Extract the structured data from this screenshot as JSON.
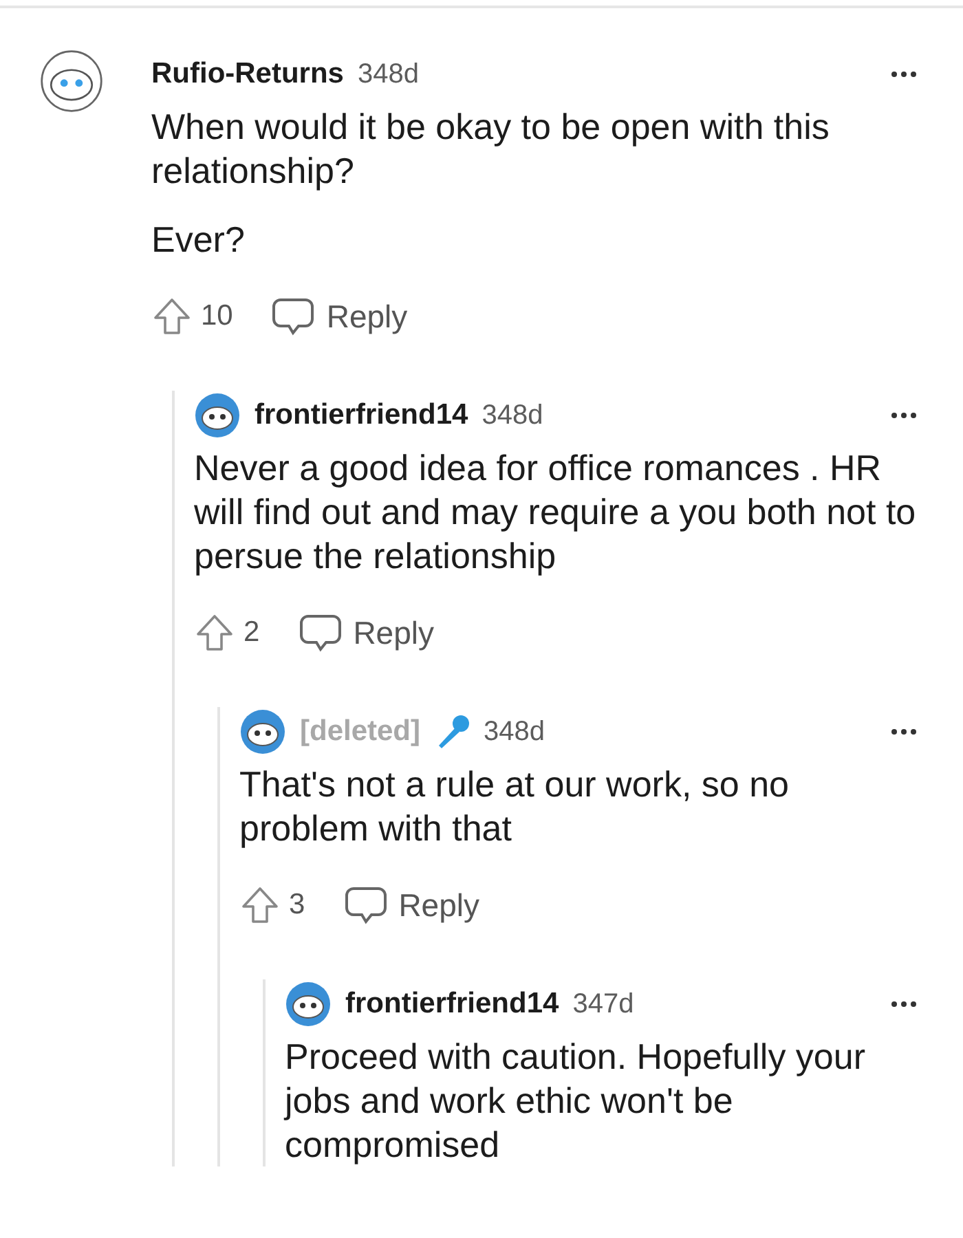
{
  "comments": [
    {
      "author": "Rufio-Returns",
      "deleted": false,
      "flair_icon": false,
      "age": "348d",
      "paragraphs": [
        "When would it be okay to be open with this relationship?",
        "Ever?"
      ],
      "votes": "10",
      "reply": "Reply",
      "children": [
        {
          "author": "frontierfriend14",
          "deleted": false,
          "flair_icon": false,
          "age": "348d",
          "paragraphs": [
            "Never a good idea for office romances . HR will find out and may require a you both not to persue the relationship"
          ],
          "votes": "2",
          "reply": "Reply",
          "children": [
            {
              "author": "[deleted]",
              "deleted": true,
              "flair_icon": true,
              "age": "348d",
              "paragraphs": [
                "That's not a rule at our work, so no problem with that"
              ],
              "votes": "3",
              "reply": "Reply",
              "children": [
                {
                  "author": "frontierfriend14",
                  "deleted": false,
                  "flair_icon": false,
                  "age": "347d",
                  "paragraphs": [
                    "Proceed with caution. Hopefully your jobs and work ethic won't be compromised"
                  ]
                }
              ]
            }
          ]
        }
      ]
    }
  ]
}
